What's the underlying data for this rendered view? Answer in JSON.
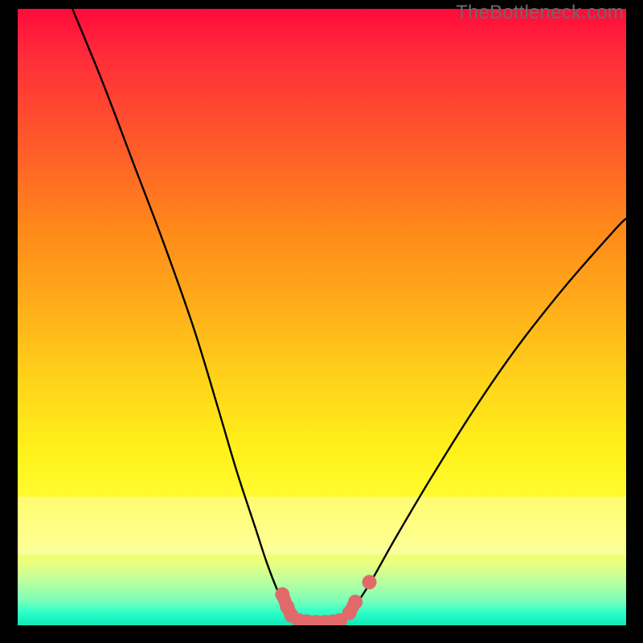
{
  "watermark": "TheBottleneck.com",
  "chart_data": {
    "type": "line",
    "title": "",
    "xlabel": "",
    "ylabel": "",
    "xlim": [
      0,
      100
    ],
    "ylim": [
      0,
      100
    ],
    "grid": false,
    "series": [
      {
        "name": "left-curve",
        "x": [
          9,
          14,
          19,
          24,
          29,
          33,
          36,
          39,
          41,
          43,
          44.5,
          45.5,
          46.2
        ],
        "y": [
          100,
          88,
          75,
          62,
          48,
          35,
          25,
          16,
          10,
          5,
          2.5,
          1.2,
          0.8
        ]
      },
      {
        "name": "valley-floor",
        "x": [
          46.2,
          48,
          50,
          52,
          53.5
        ],
        "y": [
          0.8,
          0.5,
          0.4,
          0.5,
          0.8
        ]
      },
      {
        "name": "right-curve",
        "x": [
          53.5,
          55,
          58,
          62,
          68,
          75,
          82,
          90,
          98,
          100
        ],
        "y": [
          0.8,
          2.5,
          7,
          14,
          24,
          35,
          45,
          55,
          64,
          66
        ]
      }
    ],
    "marker_groups": [
      {
        "name": "left-marker-cluster",
        "color": "#e06a6a",
        "points": [
          {
            "x": 43.5,
            "y": 5.0
          },
          {
            "x": 44.3,
            "y": 3.0
          },
          {
            "x": 45.0,
            "y": 1.6
          }
        ]
      },
      {
        "name": "floor-marker-cluster",
        "color": "#e06a6a",
        "points": [
          {
            "x": 46.2,
            "y": 0.8
          },
          {
            "x": 47.5,
            "y": 0.6
          },
          {
            "x": 49.0,
            "y": 0.5
          },
          {
            "x": 50.5,
            "y": 0.5
          },
          {
            "x": 51.8,
            "y": 0.6
          },
          {
            "x": 53.0,
            "y": 0.8
          }
        ]
      },
      {
        "name": "right-marker-cluster",
        "color": "#e06a6a",
        "points": [
          {
            "x": 54.5,
            "y": 2.0
          },
          {
            "x": 55.5,
            "y": 3.8
          }
        ]
      },
      {
        "name": "lone-marker",
        "color": "#e06a6a",
        "points": [
          {
            "x": 57.8,
            "y": 7.0
          }
        ]
      }
    ]
  }
}
